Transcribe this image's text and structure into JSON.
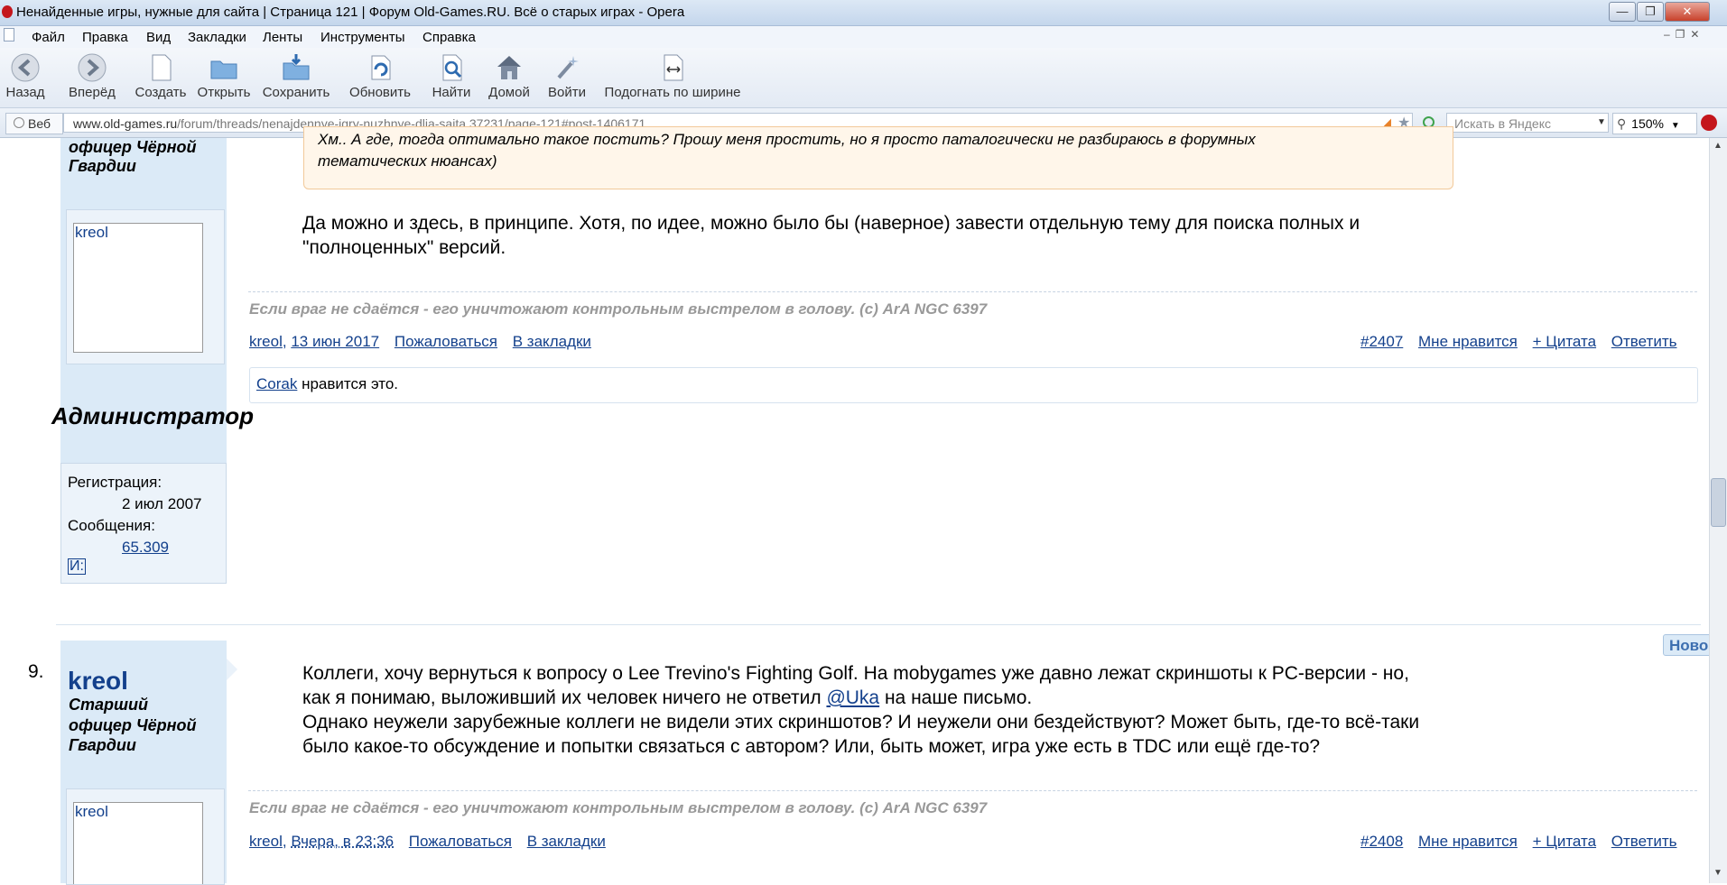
{
  "window": {
    "title": "Ненайденные игры, нужные для сайта | Страница 121 | Форум Old-Games.RU. Всё о старых играх - Opera",
    "minimize": "—",
    "maximize": "❐",
    "close": "✕"
  },
  "menu": [
    "Файл",
    "Правка",
    "Вид",
    "Закладки",
    "Ленты",
    "Инструменты",
    "Справка"
  ],
  "toolbar": {
    "back": "Назад",
    "forward": "Вперёд",
    "create": "Создать",
    "open": "Открыть",
    "save": "Сохранить",
    "reload": "Обновить",
    "find": "Найти",
    "home": "Домой",
    "login": "Войти",
    "fit": "Подогнать по ширине"
  },
  "address": {
    "web_tab": "Веб",
    "url_host": "www.old-games.ru",
    "url_path": "/forum/threads/nenajdennye-igry-nuzhnye-dlja-sajta.37231/page-121#post-1406171",
    "search_placeholder": "Искать в Яндекс",
    "zoom": "150%"
  },
  "post1": {
    "user_title_line1": "офицер Чёрной",
    "user_title_line2": "Гвардии",
    "avatar_name": "kreol",
    "role": "Администратор",
    "reg_label": "Регистрация:",
    "reg_date": "2 июл 2007",
    "msgs_label": "Сообщения:",
    "msgs_count": "65.309",
    "extra": "И:",
    "quote_line1": "Хм.. А где, тогда оптимально такое постить? Прошу меня простить, но я просто паталогически не разбираюсь в форумных",
    "quote_line2": "тематических нюансах)",
    "text_line1": "Да можно и здесь, в принципе. Хотя, по идее, можно было бы (наверное) завести отдельную тему для поиска полных и",
    "text_line2": "\"полноценных\" версий.",
    "signature": "Если враг не сдаётся - его уничтожают контрольным выстрелом в голову. (c) ArA NGC 6397",
    "author": "kreol",
    "date": "13 июн 2017",
    "report": "Пожаловаться",
    "bookmark": "В закладки",
    "post_num": "#2407",
    "like": "Мне нравится",
    "quote": "+ Цитата",
    "reply": "Ответить",
    "liked_user": "Corak",
    "liked_text": "нравится это."
  },
  "post2": {
    "number": "9.",
    "username": "kreol",
    "user_title_line1": "Старший",
    "user_title_line2": "офицер Чёрной",
    "user_title_line3": "Гвардии",
    "avatar_name": "kreol",
    "new_badge": "Ново",
    "text_line1": "Коллеги, хочу вернуться к вопросу о Lee Trevino's Fighting Golf. На mobygames уже давно лежат скриншоты к PC-версии - но,",
    "text_line2_pre": "как я понимаю, выложивший их человек ничего не ответил ",
    "mention": "@Uka",
    "text_line2_post": " на наше письмо.",
    "text_line3": "Однако неужели зарубежные коллеги не видели этих скриншотов? И неужели они бездействуют? Может быть, где-то всё-таки",
    "text_line4": "было какое-то обсуждение и попытки связаться с автором? Или, быть может, игра уже есть в TDC или ещё где-то?",
    "signature": "Если враг не сдаётся - его уничтожают контрольным выстрелом в голову. (c) ArA NGC 6397",
    "author": "kreol",
    "date": "Вчера, в 23:36",
    "report": "Пожаловаться",
    "bookmark": "В закладки",
    "post_num": "#2408",
    "like": "Мне нравится",
    "quote": "+ Цитата",
    "reply": "Ответить"
  },
  "colors": {
    "link": "#13408c",
    "sidebar": "#dbeaf7",
    "quote_border": "#f2c99a",
    "signature": "#999999"
  }
}
